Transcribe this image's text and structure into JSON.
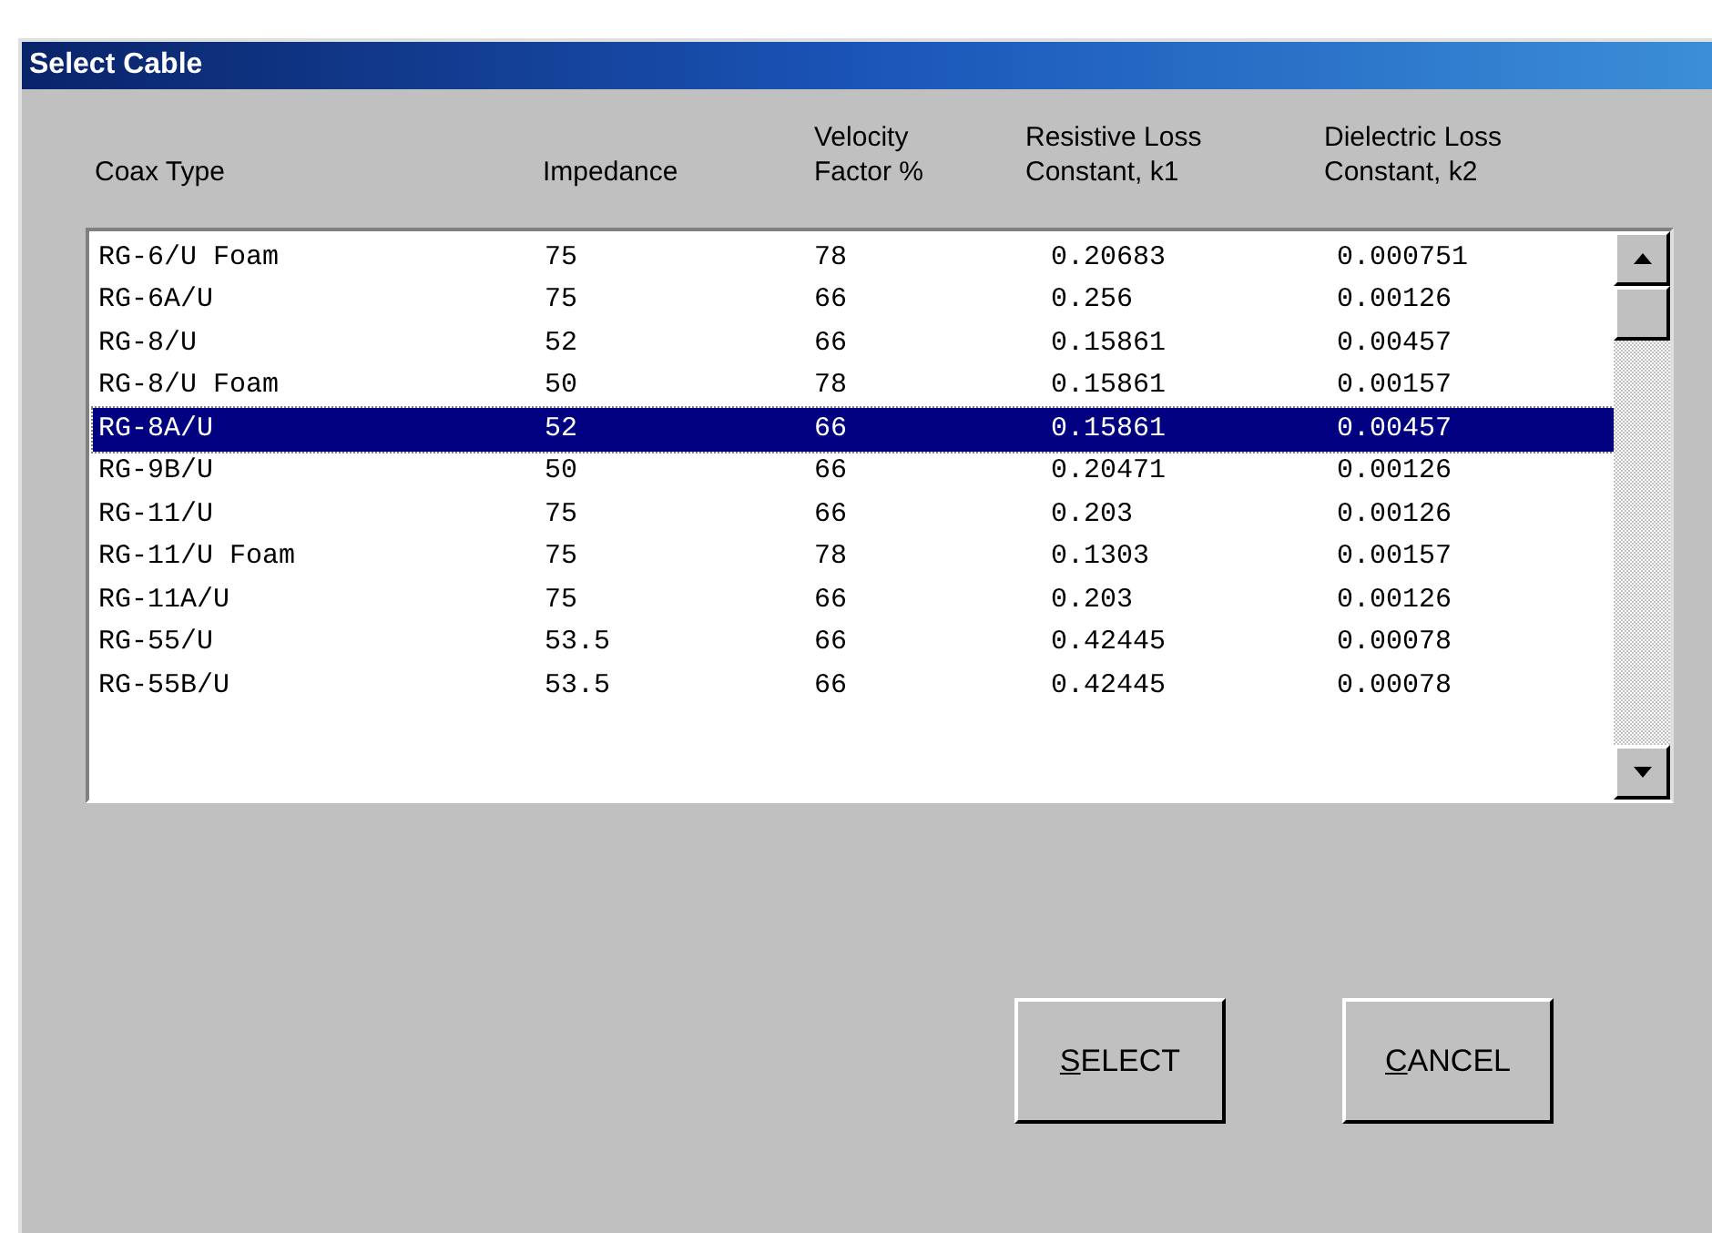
{
  "window": {
    "title": "Select Cable"
  },
  "table": {
    "columns": [
      "Coax Type",
      "Impedance",
      "Velocity Factor %",
      "Resistive Loss Constant, k1",
      "Dielectric Loss Constant, k2"
    ],
    "rows": [
      {
        "cells": [
          "RG-6/U Foam",
          "75",
          "78",
          "0.20683",
          "0.000751"
        ],
        "selected": false
      },
      {
        "cells": [
          "RG-6A/U",
          "75",
          "66",
          "0.256",
          "0.00126"
        ],
        "selected": false
      },
      {
        "cells": [
          "RG-8/U",
          "52",
          "66",
          "0.15861",
          "0.00457"
        ],
        "selected": false
      },
      {
        "cells": [
          "RG-8/U Foam",
          "50",
          "78",
          "0.15861",
          "0.00157"
        ],
        "selected": false
      },
      {
        "cells": [
          "RG-8A/U",
          "52",
          "66",
          "0.15861",
          "0.00457"
        ],
        "selected": true
      },
      {
        "cells": [
          "RG-9B/U",
          "50",
          "66",
          "0.20471",
          "0.00126"
        ],
        "selected": false
      },
      {
        "cells": [
          "RG-11/U",
          "75",
          "66",
          "0.203",
          "0.00126"
        ],
        "selected": false
      },
      {
        "cells": [
          "RG-11/U Foam",
          "75",
          "78",
          "0.1303",
          "0.00157"
        ],
        "selected": false
      },
      {
        "cells": [
          "RG-11A/U",
          "75",
          "66",
          "0.203",
          "0.00126"
        ],
        "selected": false
      },
      {
        "cells": [
          "RG-55/U",
          "53.5",
          "66",
          "0.42445",
          "0.00078"
        ],
        "selected": false
      },
      {
        "cells": [
          "RG-55B/U",
          "53.5",
          "66",
          "0.42445",
          "0.00078"
        ],
        "selected": false
      }
    ]
  },
  "buttons": [
    {
      "accel": "S",
      "rest": "ELECT"
    },
    {
      "accel": "C",
      "rest": "ANCEL"
    }
  ]
}
